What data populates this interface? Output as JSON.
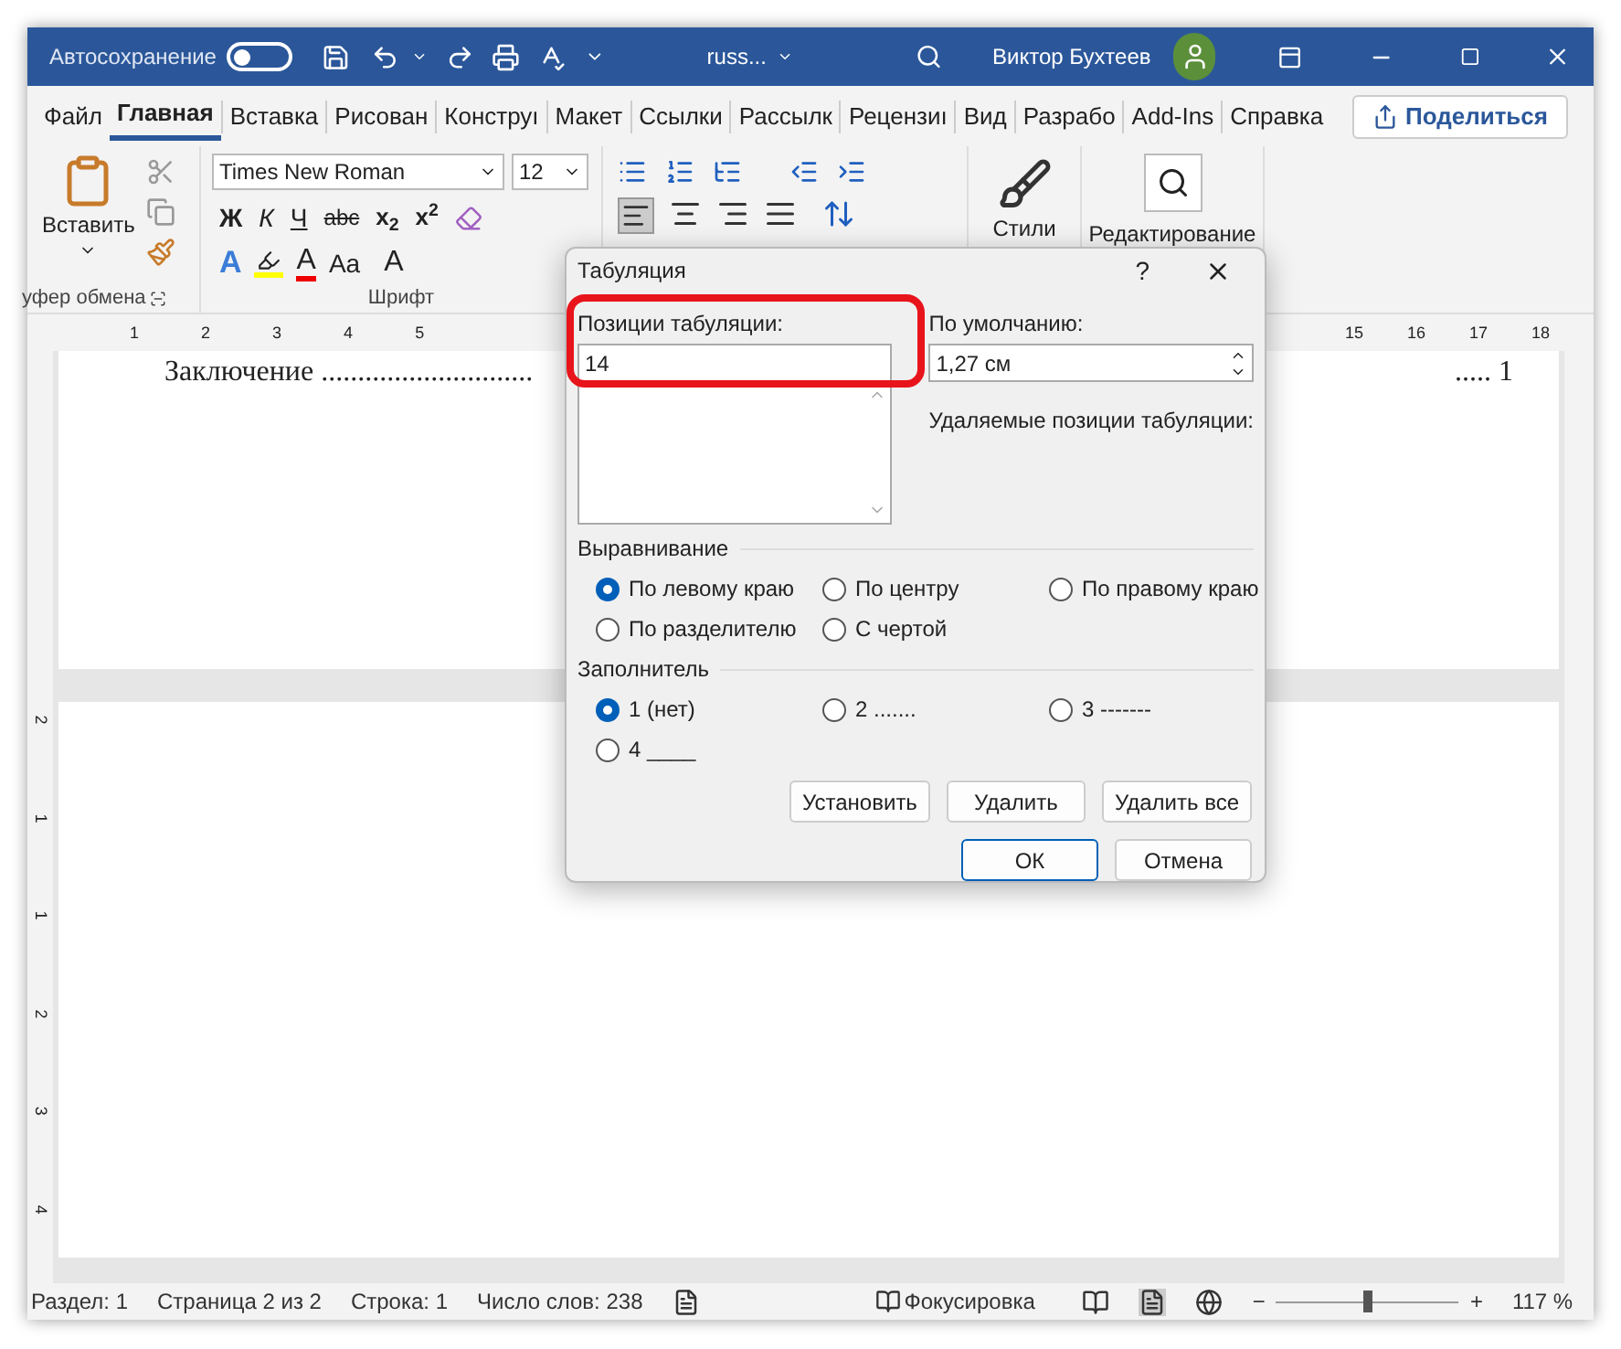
{
  "title_bar": {
    "autosave_label": "Автосохранение",
    "autosave_on": false,
    "file_name": "russ...",
    "user_name": "Виктор Бухтеев"
  },
  "tabs": [
    {
      "label": "Файл",
      "selected": false
    },
    {
      "label": "Главная",
      "selected": true
    },
    {
      "label": "Вставка",
      "selected": false
    },
    {
      "label": "Рисован",
      "selected": false
    },
    {
      "label": "Конструı",
      "selected": false
    },
    {
      "label": "Макет",
      "selected": false
    },
    {
      "label": "Ссылки",
      "selected": false
    },
    {
      "label": "Рассылк",
      "selected": false
    },
    {
      "label": "Рецензиı",
      "selected": false
    },
    {
      "label": "Вид",
      "selected": false
    },
    {
      "label": "Разрабо",
      "selected": false
    },
    {
      "label": "Add-Ins",
      "selected": false
    },
    {
      "label": "Справка",
      "selected": false
    }
  ],
  "share_button": "Поделиться",
  "ribbon": {
    "clipboard": {
      "paste": "Вставить",
      "label": "уфер обмена"
    },
    "font": {
      "name": "Times New Roman",
      "size": "12",
      "format_buttons": [
        "Ж",
        "К",
        "Ч",
        "abc",
        "x$_{2}$",
        "x$^{2}$"
      ],
      "effects": "A",
      "font_color_letter": "A",
      "case": "Aa",
      "grow": "A",
      "label": "Шрифт"
    },
    "styles": "Стили",
    "editing": "Редактирование"
  },
  "ruler": {
    "left_numbers": [
      "1",
      "2",
      "3",
      "4",
      "5"
    ],
    "right_numbers": [
      "15",
      "16",
      "17",
      "18"
    ]
  },
  "vertical_ruler": [
    "2",
    "1",
    "1",
    "2",
    "3",
    "4"
  ],
  "document": {
    "line_left": "Заключение .............................",
    "line_right": "..... 1"
  },
  "dialog": {
    "title": "Табуляция",
    "help": "?",
    "positions": {
      "label": "Позиции табуляции:",
      "value": "14",
      "highlighted": true
    },
    "default": {
      "label": "По умолчанию:",
      "value": "1,27 см"
    },
    "removed_label": "Удаляемые позиции табуляции:",
    "alignment": {
      "label": "Выравнивание",
      "options": [
        {
          "label": "По левому краю",
          "selected": true
        },
        {
          "label": "По центру",
          "selected": false
        },
        {
          "label": "По правому краю",
          "selected": false
        },
        {
          "label": "По разделителю",
          "selected": false
        },
        {
          "label": "С чертой",
          "selected": false
        }
      ]
    },
    "leader": {
      "label": "Заполнитель",
      "options": [
        {
          "label": "1 (нет)",
          "selected": true
        },
        {
          "label": "2 .......",
          "selected": false
        },
        {
          "label": "3 -------",
          "selected": false
        },
        {
          "label": "4 ____",
          "selected": false
        }
      ]
    },
    "action_buttons": [
      "Установить",
      "Удалить",
      "Удалить все"
    ],
    "buttons": [
      {
        "label": "ОК",
        "primary": true
      },
      {
        "label": "Отмена",
        "primary": false
      }
    ]
  },
  "status_bar": {
    "items": [
      "Раздел: 1",
      "Страница 2 из 2",
      "Строка: 1",
      "Число слов: 238"
    ],
    "focus": "Фокусировка",
    "zoom_minus": "−",
    "zoom_plus": "+",
    "level": 0.5,
    "zoom": "117 %"
  }
}
